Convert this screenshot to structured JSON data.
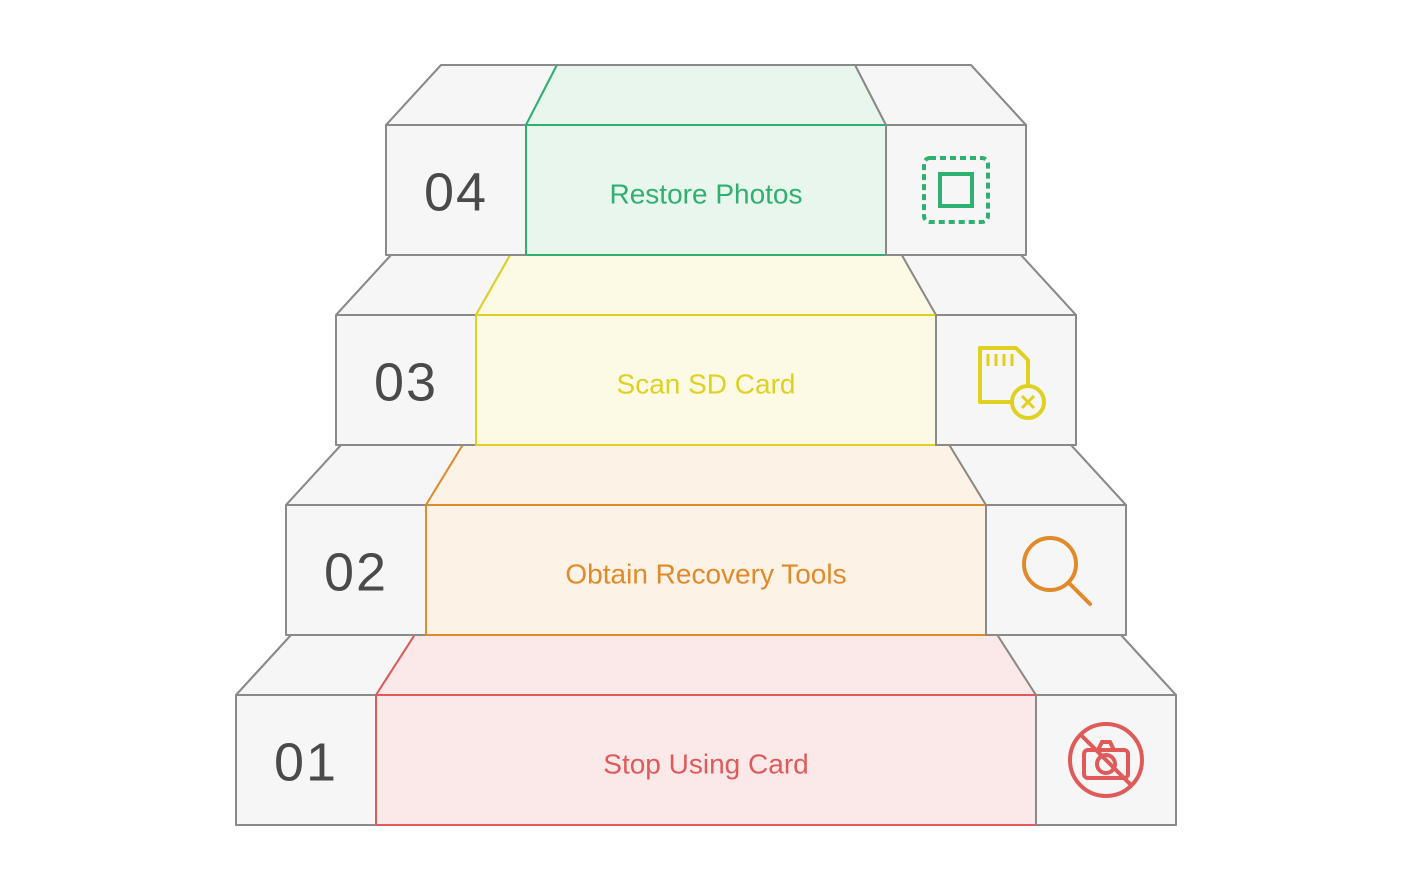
{
  "steps": [
    {
      "number": "01",
      "label": "Stop Using Card",
      "color": "#e05a5a",
      "fill": "#fbe9e9",
      "icon": "no-camera"
    },
    {
      "number": "02",
      "label": "Obtain Recovery Tools",
      "color": "#e08a2a",
      "fill": "#fcf2e5",
      "icon": "magnify"
    },
    {
      "number": "03",
      "label": "Scan SD Card",
      "color": "#e0d020",
      "fill": "#fcfae5",
      "icon": "sd-card"
    },
    {
      "number": "04",
      "label": "Restore Photos",
      "color": "#30b070",
      "fill": "#e8f6ee",
      "icon": "photo-frame"
    }
  ]
}
